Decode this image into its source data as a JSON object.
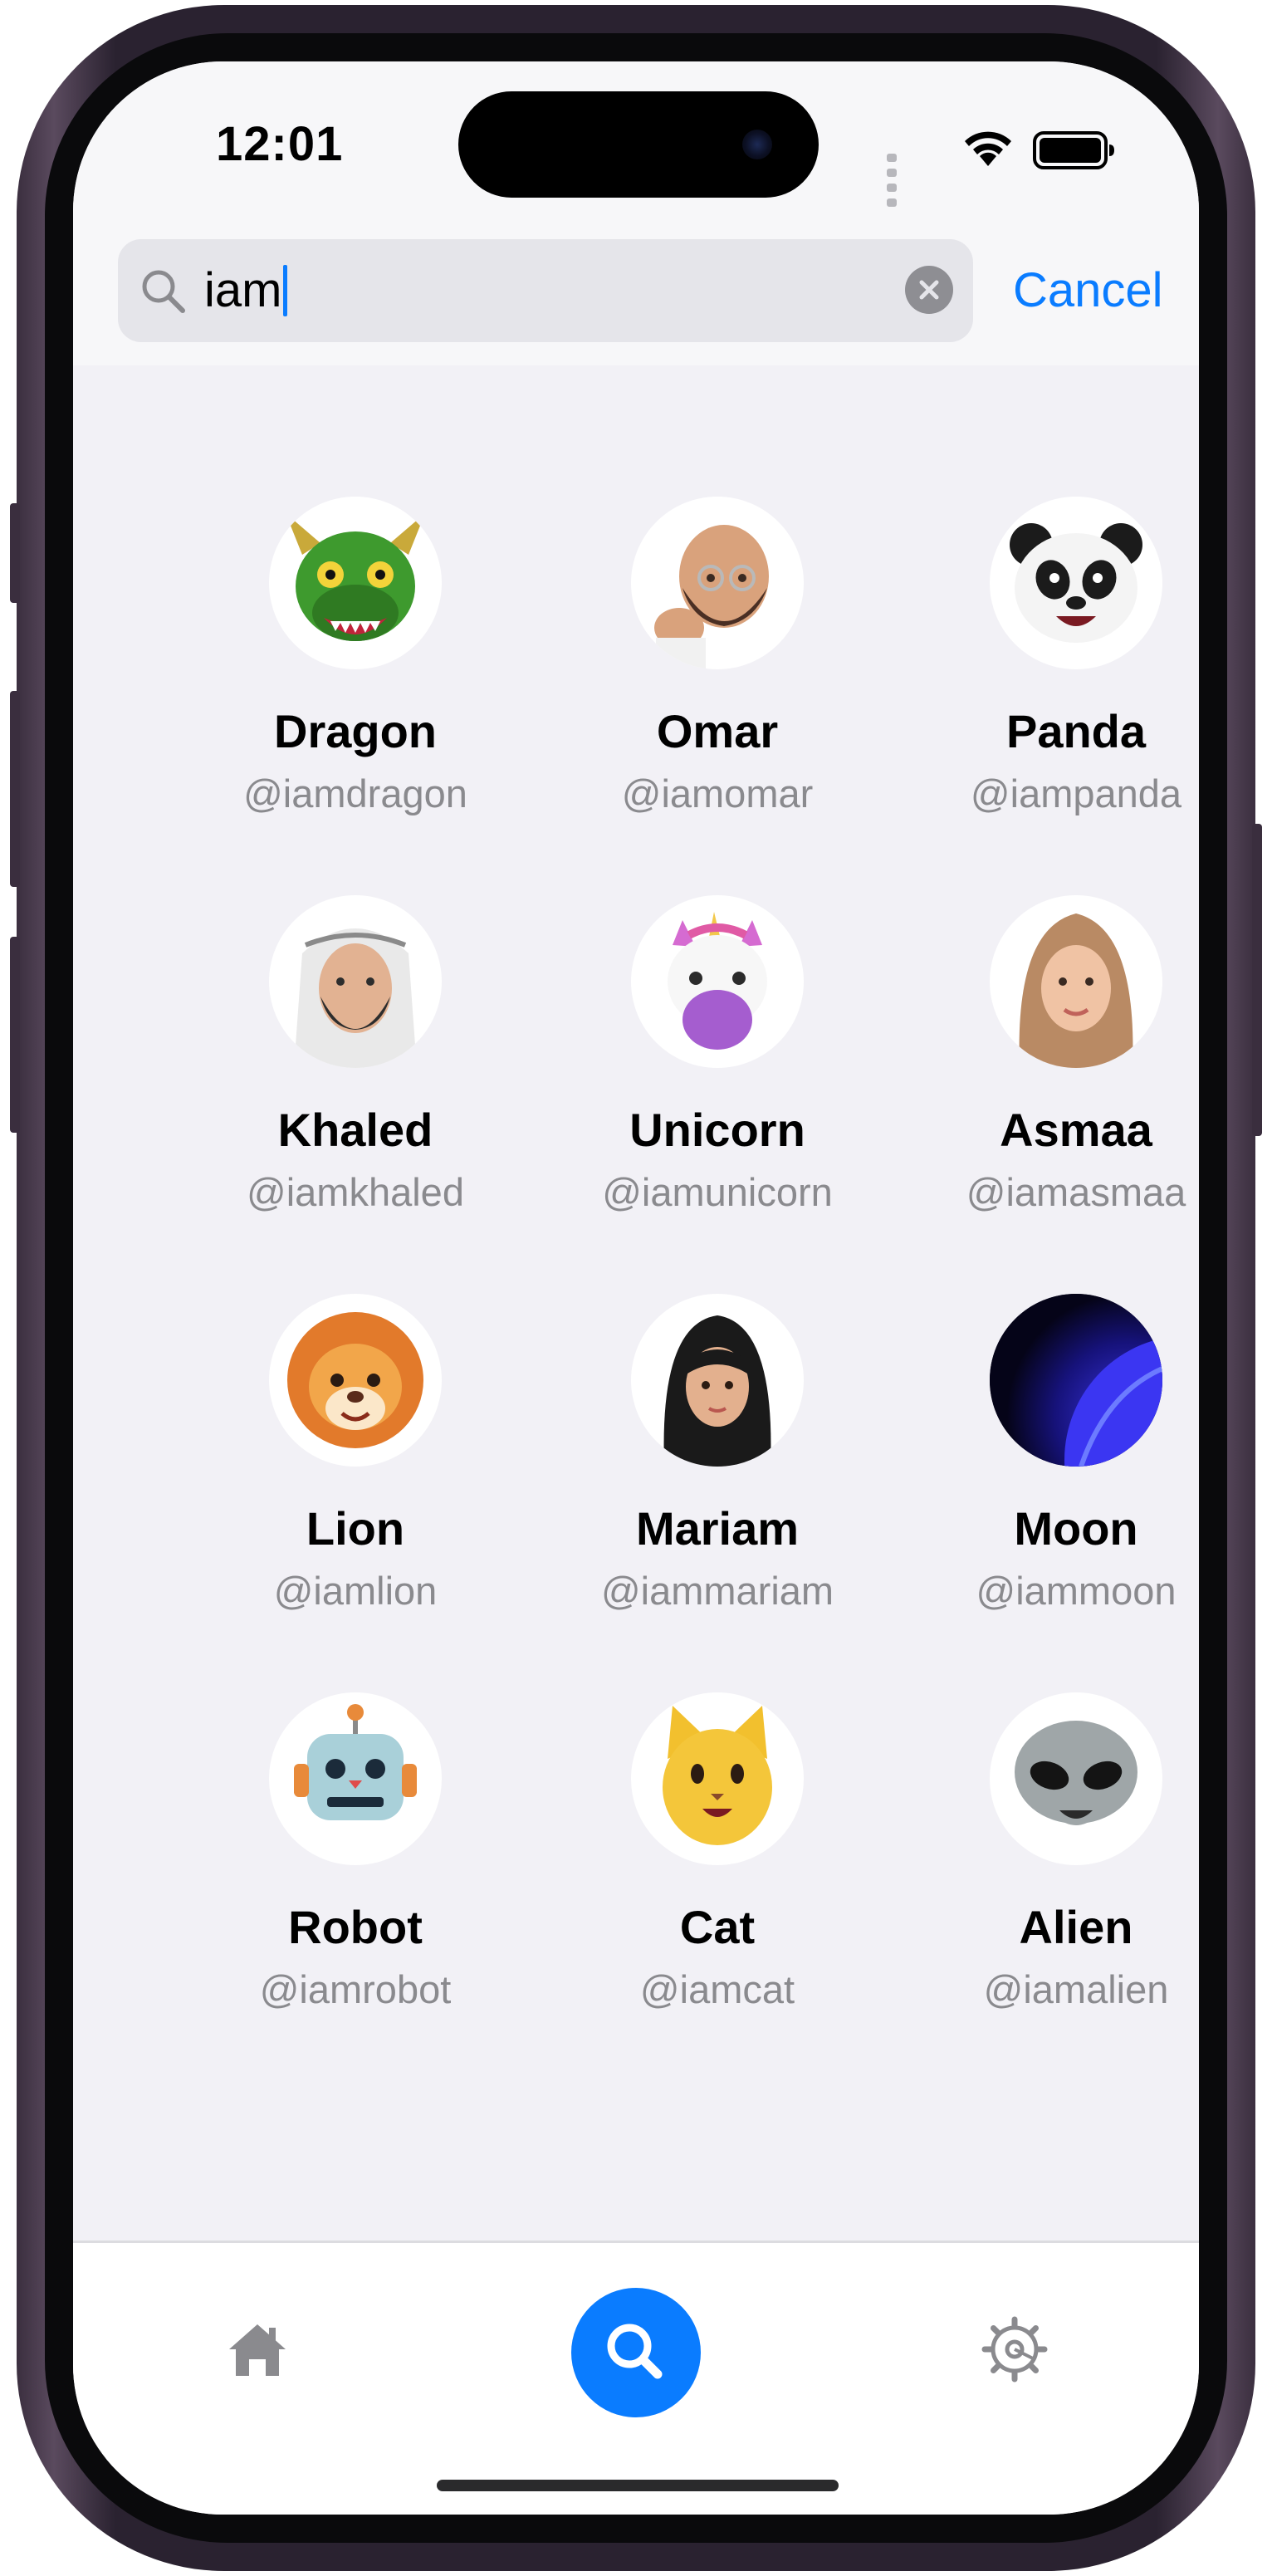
{
  "status_bar": {
    "time": "12:01"
  },
  "search": {
    "query": "iam",
    "cancel_label": "Cancel"
  },
  "results": [
    {
      "name": "Dragon",
      "handle": "@iamdragon",
      "avatar_icon": "dragon-memoji-icon"
    },
    {
      "name": "Omar",
      "handle": "@iamomar",
      "avatar_icon": "bald-bearded-man-memoji-icon"
    },
    {
      "name": "Panda",
      "handle": "@iampanda",
      "avatar_icon": "panda-memoji-icon"
    },
    {
      "name": "Khaled",
      "handle": "@iamkhaled",
      "avatar_icon": "man-headscarf-memoji-icon"
    },
    {
      "name": "Unicorn",
      "handle": "@iamunicorn",
      "avatar_icon": "unicorn-memoji-icon"
    },
    {
      "name": "Asmaa",
      "handle": "@iamasmaa",
      "avatar_icon": "woman-hijab-memoji-icon"
    },
    {
      "name": "Lion",
      "handle": "@iamlion",
      "avatar_icon": "lion-memoji-icon"
    },
    {
      "name": "Mariam",
      "handle": "@iammariam",
      "avatar_icon": "woman-black-hijab-memoji-icon"
    },
    {
      "name": "Moon",
      "handle": "@iammoon",
      "avatar_icon": "moon-space-icon"
    },
    {
      "name": "Robot",
      "handle": "@iamrobot",
      "avatar_icon": "robot-memoji-icon"
    },
    {
      "name": "Cat",
      "handle": "@iamcat",
      "avatar_icon": "cat-memoji-icon"
    },
    {
      "name": "Alien",
      "handle": "@iamalien",
      "avatar_icon": "alien-memoji-icon"
    }
  ],
  "tab_bar": {
    "items": [
      {
        "icon": "house-icon",
        "active": false
      },
      {
        "icon": "magnifying-glass-icon",
        "active": true
      },
      {
        "icon": "gear-icon",
        "active": false
      }
    ]
  },
  "colors": {
    "accent": "#0a7cff",
    "background": "#f2f1f6",
    "handle_text": "#8a8a8e"
  }
}
